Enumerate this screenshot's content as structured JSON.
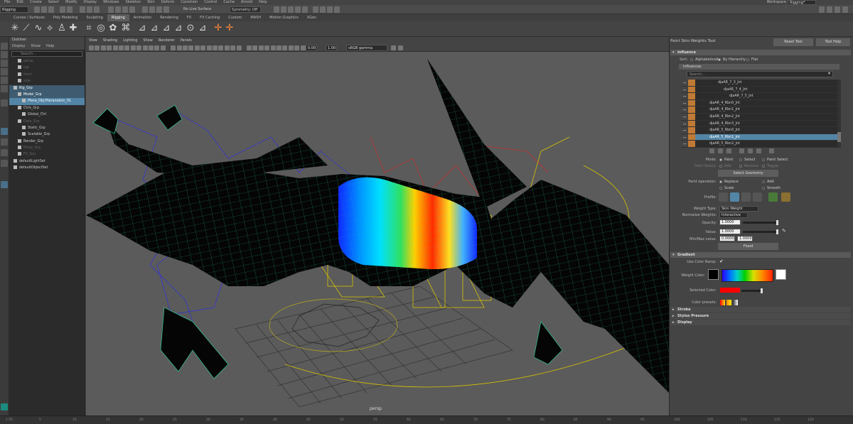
{
  "menubar": {
    "items": [
      "File",
      "Edit",
      "Create",
      "Select",
      "Modify",
      "Display",
      "Windows",
      "Skeleton",
      "Skin",
      "Deform",
      "Constrain",
      "Control",
      "Cache",
      "Arnold",
      "Help"
    ]
  },
  "statusline": {
    "mode": "Rigging",
    "live_surface": "No Live Surface",
    "symmetry": "Symmetry: Off",
    "workspace_label": "Workspace :",
    "workspace": "Rigging*"
  },
  "shelf": {
    "tabs": [
      "Curves / Surfaces",
      "Poly Modeling",
      "Sculpting",
      "Rigging",
      "Animation",
      "Rendering",
      "FX",
      "FX Caching",
      "Custom",
      "MASH",
      "Motion Graphics",
      "XGen"
    ],
    "active_tab": "Rigging"
  },
  "outliner": {
    "title": "Outliner",
    "menu": [
      "Display",
      "Show",
      "Help"
    ],
    "search_placeholder": "Search...",
    "items": [
      {
        "label": "persp",
        "indent": 2,
        "state": "dim"
      },
      {
        "label": "top",
        "indent": 2,
        "state": "dim"
      },
      {
        "label": "front",
        "indent": 2,
        "state": "dim"
      },
      {
        "label": "side",
        "indent": 2,
        "state": "dim"
      },
      {
        "label": "Rig_Grp",
        "indent": 1,
        "state": "sel2"
      },
      {
        "label": "Model_Grp",
        "indent": 2,
        "state": "sel2"
      },
      {
        "label": "Ptera_Obj:Pteranodon_01",
        "indent": 3,
        "state": "sel"
      },
      {
        "label": "Ctrls_Grp",
        "indent": 2,
        "state": ""
      },
      {
        "label": "Global_Ctrl",
        "indent": 3,
        "state": ""
      },
      {
        "label": "Data_Grp",
        "indent": 2,
        "state": "dim"
      },
      {
        "label": "Static_Grp",
        "indent": 3,
        "state": ""
      },
      {
        "label": "Scalable_Grp",
        "indent": 3,
        "state": ""
      },
      {
        "label": "Render_Grp",
        "indent": 2,
        "state": ""
      },
      {
        "label": "Proxy_Grp",
        "indent": 2,
        "state": "dim"
      },
      {
        "label": "FX_Grp",
        "indent": 2,
        "state": "dim"
      },
      {
        "label": "defaultLightSet",
        "indent": 1,
        "state": ""
      },
      {
        "label": "defaultObjectSet",
        "indent": 1,
        "state": ""
      }
    ]
  },
  "viewport": {
    "menu": [
      "View",
      "Shading",
      "Lighting",
      "Show",
      "Renderer",
      "Panels"
    ],
    "field1": "0.00",
    "field2": "1.00",
    "color_space": "sRGB gamma",
    "camera": "persp"
  },
  "timeline": {
    "ticks": [
      "1.50",
      "5",
      "10",
      "15",
      "20",
      "25",
      "30",
      "35",
      "40",
      "45",
      "50",
      "55",
      "60",
      "65",
      "70",
      "75",
      "80",
      "85",
      "90",
      "95",
      "100",
      "105",
      "110",
      "115",
      "120"
    ]
  },
  "panel": {
    "title": "Paint Skin Weights Tool",
    "reset_label": "Reset Tool",
    "help_label": "Tool Help",
    "influence_section": "Influence",
    "sort_label": "Sort:",
    "sort_options": [
      "Alphabetically",
      "By Hierarchy",
      "Flat"
    ],
    "sort_selected": "By Hierarchy",
    "influences_label": "Influences",
    "search_placeholder": "Search...",
    "influences": [
      {
        "name": "djaAR_7_3_Jnt",
        "indent": 28,
        "sel": false
      },
      {
        "name": "djaAR_7_4_Jnt",
        "indent": 36,
        "sel": false
      },
      {
        "name": "djaAR_7_5_Jnt",
        "indent": 44,
        "sel": false
      },
      {
        "name": "djaAR_4_Rbn0_Jnt",
        "indent": 16,
        "sel": false
      },
      {
        "name": "djaAR_4_Rbn1_Jnt",
        "indent": 16,
        "sel": false
      },
      {
        "name": "djaAR_4_Rbn2_Jnt",
        "indent": 16,
        "sel": false
      },
      {
        "name": "djaAR_4_Rbn3_Jnt",
        "indent": 16,
        "sel": false
      },
      {
        "name": "djaAR_5_Rbn0_Jnt",
        "indent": 16,
        "sel": false
      },
      {
        "name": "djaAR_5_Rbn1_Jnt",
        "indent": 16,
        "sel": true
      },
      {
        "name": "djaAR_5_Rbn2_Jnt",
        "indent": 16,
        "sel": false
      }
    ],
    "mode_label": "Mode:",
    "mode_options": [
      "Paint",
      "Select",
      "Paint Select"
    ],
    "paint_select_label": "Paint Select:",
    "paint_select_options": [
      "Add",
      "Remove",
      "Toggle"
    ],
    "select_geometry": "Select Geometry",
    "paint_op_label": "Paint operation:",
    "paint_ops": [
      "Replace",
      "Add",
      "Scale",
      "Smooth"
    ],
    "profile_label": "Profile:",
    "weight_type_label": "Weight Type:",
    "weight_type": "Skin Weight",
    "normalize_label": "Normalize Weights:",
    "normalize": "Interactive",
    "opacity_label": "Opacity:",
    "opacity": "1.0000",
    "value_label": "Value:",
    "value": "1.0000",
    "minmax_label": "Min/Max value:",
    "min": "0.0000",
    "max": "1.0000",
    "flood": "Flood",
    "gradient_section": "Gradient",
    "use_ramp_label": "Use Color Ramp:",
    "weight_color_label": "Weight Color:",
    "selected_color_label": "Selected Color:",
    "presets_label": "Color presets:",
    "stroke_section": "Stroke",
    "stylus_section": "Stylus Pressure",
    "display_section": "Display"
  }
}
